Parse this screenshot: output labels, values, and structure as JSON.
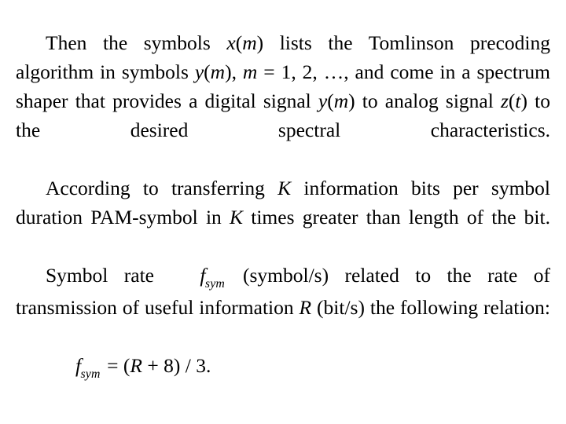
{
  "document": {
    "background_color": "#ffffff",
    "text_color": "#000000",
    "paragraphs": [
      {
        "id": "paragraph-tomlinson",
        "runs": [
          {
            "text": "Then the symbols ",
            "style": "roman"
          },
          {
            "text": "x",
            "style": "italic"
          },
          {
            "text": "(",
            "style": "roman"
          },
          {
            "text": "m",
            "style": "italic"
          },
          {
            "text": ") lists the Tomlinson precoding algorithm in symbols ",
            "style": "roman"
          },
          {
            "text": "y",
            "style": "italic"
          },
          {
            "text": "(",
            "style": "roman"
          },
          {
            "text": "m",
            "style": "italic"
          },
          {
            "text": "), ",
            "style": "roman"
          },
          {
            "text": "m",
            "style": "italic"
          },
          {
            "text": " = 1, 2, …, and come in a spectrum shaper that provides a digital signal ",
            "style": "roman"
          },
          {
            "text": "y",
            "style": "italic"
          },
          {
            "text": "(",
            "style": "roman"
          },
          {
            "text": "m",
            "style": "italic"
          },
          {
            "text": ") to analog signal ",
            "style": "roman"
          },
          {
            "text": "z",
            "style": "italic"
          },
          {
            "text": "(",
            "style": "roman"
          },
          {
            "text": "t",
            "style": "italic"
          },
          {
            "text": ") to the desired spectral characteristics.",
            "style": "roman"
          }
        ],
        "plain_text": "Then the symbols x(m) lists the Tomlinson precoding algorithm in symbols y(m), m = 1, 2, …, and come in a spectrum shaper that provides a digital signal y(m) to analog signal z(t) to the desired spectral characteristics."
      },
      {
        "id": "paragraph-according",
        "runs": [
          {
            "text": "According to transferring ",
            "style": "roman"
          },
          {
            "text": "K",
            "style": "italic"
          },
          {
            "text": " information bits per symbol duration PAM-symbol in ",
            "style": "roman"
          },
          {
            "text": "K",
            "style": "italic"
          },
          {
            "text": " times greater than length of the bit.",
            "style": "roman"
          }
        ],
        "plain_text": "According to transferring K information bits per symbol duration PAM-symbol in K times greater than length of the bit."
      },
      {
        "id": "paragraph-symbol-rate",
        "runs": [
          {
            "text": "Symbol rate ",
            "style": "roman"
          },
          {
            "text": "f",
            "style": "italic-sub",
            "subscript": "sym"
          },
          {
            "text": " (symbol/s) related to the rate of transmission of useful information ",
            "style": "roman"
          },
          {
            "text": "R",
            "style": "italic"
          },
          {
            "text": " (bit/s) the following relation:",
            "style": "roman"
          }
        ],
        "plain_text": "Symbol rate f_sym (symbol/s) related to the rate of transmission of useful information R (bit/s) the following relation:"
      }
    ],
    "formula": {
      "id": "formula-symbol-rate",
      "lhs_symbol": "f",
      "lhs_subscript": "sym",
      "equals": "=",
      "open_paren": "(",
      "rhs_variable": "R",
      "plus": "+",
      "constant": "8",
      "close_paren": ")",
      "divide": "/",
      "divisor": "3",
      "terminator": ".",
      "plain_text": "f_sym = (R + 8) / 3."
    }
  }
}
